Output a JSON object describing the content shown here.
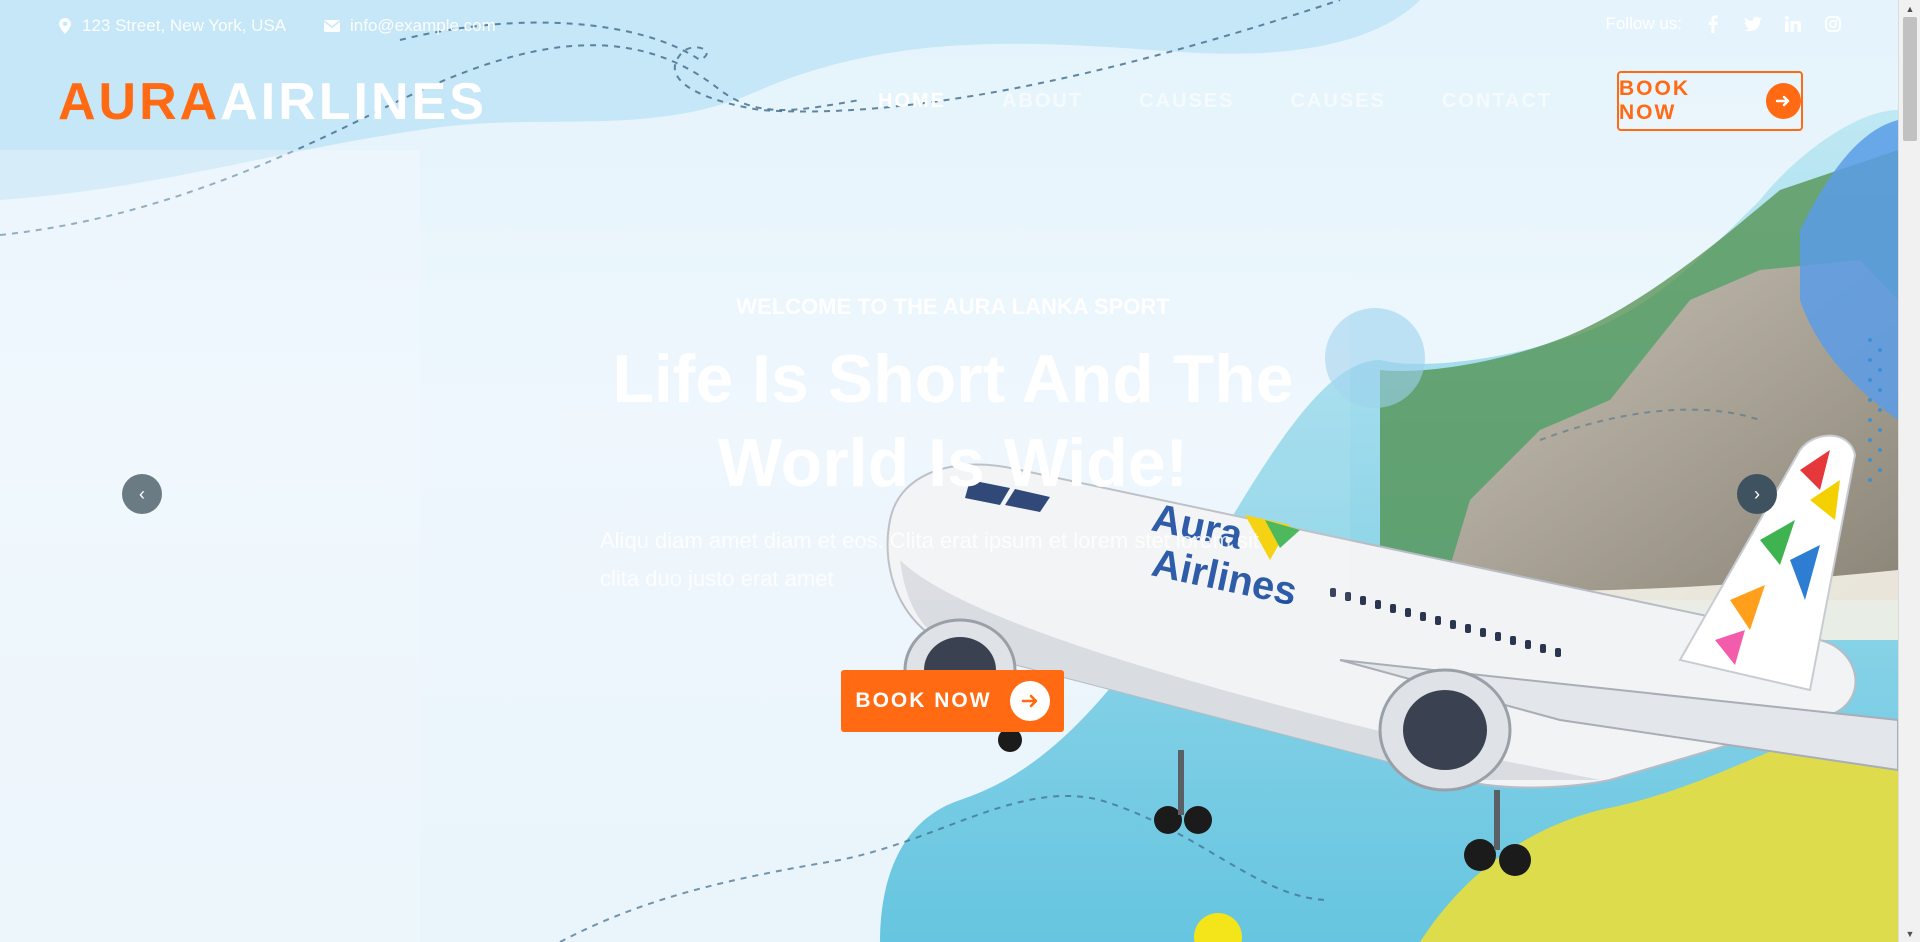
{
  "topbar": {
    "address": "123 Street, New York, USA",
    "email": "info@example.com",
    "follow_label": "Follow us:",
    "social": [
      "facebook-icon",
      "twitter-icon",
      "linkedin-icon",
      "instagram-icon"
    ]
  },
  "logo": {
    "part1": "AURA",
    "part2": "AIRLINES"
  },
  "nav": {
    "items": [
      {
        "label": "HOME"
      },
      {
        "label": "ABOUT"
      },
      {
        "label": "CAUSES"
      },
      {
        "label": "CAUSES"
      },
      {
        "label": "CONTACT"
      }
    ],
    "book_label": "BOOK NOW"
  },
  "hero": {
    "subtitle": "WELCOME TO THE AURA LANKA SPORT",
    "title": "Life Is Short And The World Is Wide!",
    "description": "Aliqu diam amet diam et eos. Clita erat ipsum et lorem stet lorem sit clita duo justo erat amet",
    "book_label": "BOOK NOW",
    "prev_label": "‹",
    "next_label": "›",
    "plane_brand_1": "Aura",
    "plane_brand_2": "Airlines"
  },
  "colors": {
    "accent": "#ff6a13",
    "sky": "#bfe4f7",
    "sand": "#e9de3c"
  }
}
